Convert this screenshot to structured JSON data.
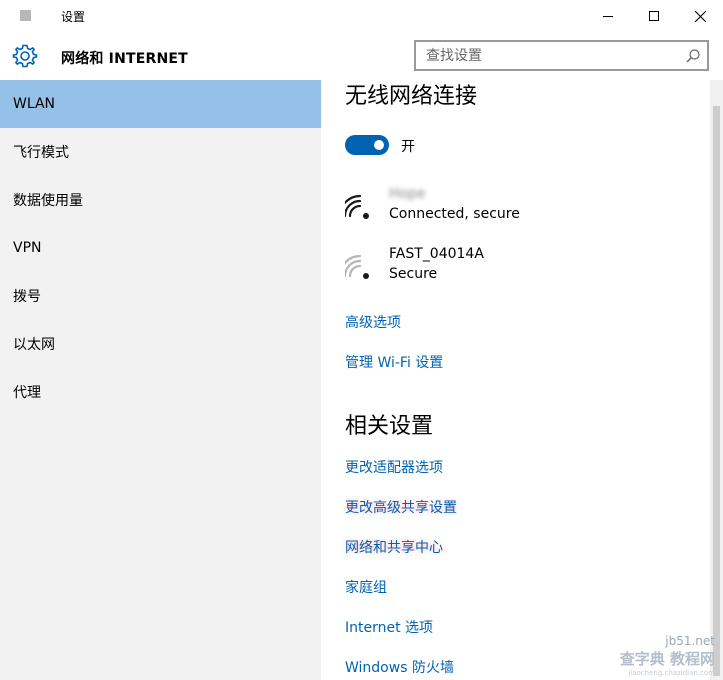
{
  "window": {
    "title": "设置",
    "icon": "settings-app-icon",
    "controls": [
      "minimize-icon",
      "maximize-icon",
      "close-icon"
    ]
  },
  "header": {
    "icon": "gear-icon",
    "title": "网络和 INTERNET",
    "search": {
      "placeholder": "查找设置",
      "value": ""
    }
  },
  "sidebar": {
    "items": [
      {
        "label": "WLAN",
        "active": true
      },
      {
        "label": "飞行模式"
      },
      {
        "label": "数据使用量"
      },
      {
        "label": "VPN"
      },
      {
        "label": "拨号"
      },
      {
        "label": "以太网"
      },
      {
        "label": "代理"
      }
    ]
  },
  "wireless": {
    "title": "无线网络连接",
    "toggle": {
      "state": "on",
      "label": "开"
    },
    "networks": [
      {
        "name": "Hope",
        "status": "Connected, secure",
        "strength": "full",
        "name_blurred": true
      },
      {
        "name": "FAST_04014A",
        "status": "Secure",
        "strength": "weak"
      }
    ],
    "links": [
      "高级选项",
      "管理 Wi-Fi 设置"
    ]
  },
  "related": {
    "title": "相关设置",
    "links": [
      "更改适配器选项",
      "更改高级共享设置",
      "网络和共享中心",
      "家庭组",
      "Internet 选项",
      "Windows 防火墙"
    ]
  },
  "watermark": {
    "top": "jb51.net",
    "main": "查字典 教程网",
    "sub": "jiaocheng.chazidian.com"
  },
  "colors": {
    "accent": "#0063b1",
    "sidebar_bg": "#f2f2f2",
    "active_item": "#95c1e8",
    "link": "#0063b1"
  }
}
